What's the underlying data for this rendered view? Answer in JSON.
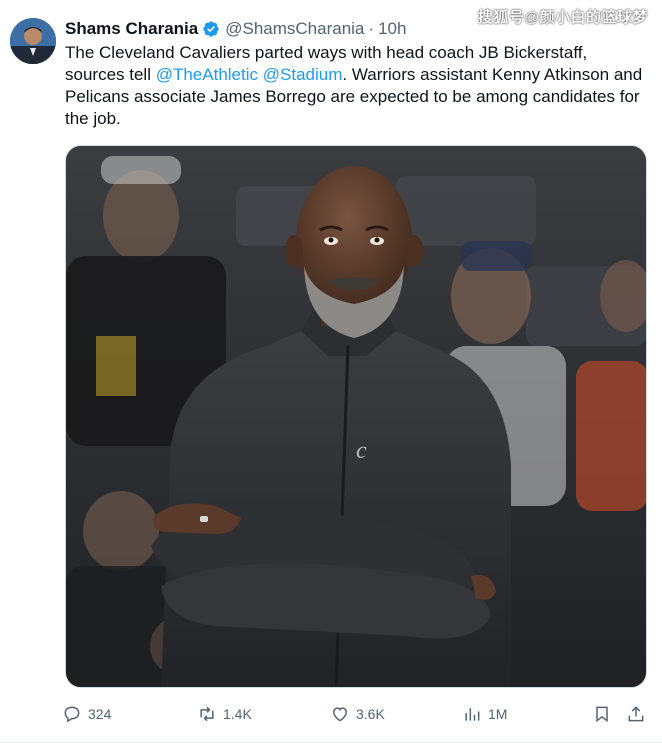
{
  "author": {
    "display_name": "Shams Charania",
    "handle": "@ShamsCharania",
    "separator": "·",
    "time": "10h",
    "verified": true,
    "verified_color": "#1d9bf0"
  },
  "watermark": "搜狐号@颜小白的篮球梦",
  "tweet": {
    "text_1": "The Cleveland Cavaliers parted ways with head coach JB Bickerstaff, sources tell ",
    "mention_1": "@TheAthletic",
    "text_2": " ",
    "mention_2": "@Stadium",
    "text_3": ". Warriors assistant Kenny Atkinson and Pelicans associate James Borrego are expected to be among candidates for the job."
  },
  "actions": {
    "replies": "324",
    "reposts": "1.4K",
    "likes": "3.6K",
    "views": "1M"
  },
  "icons": {
    "reply": "reply-icon",
    "repost": "repost-icon",
    "like": "heart-icon",
    "views": "views-icon",
    "bookmark": "bookmark-icon",
    "share": "share-icon"
  },
  "colors": {
    "link": "#1d9bf0",
    "secondary_text": "#536471",
    "primary_text": "#0f1419"
  }
}
